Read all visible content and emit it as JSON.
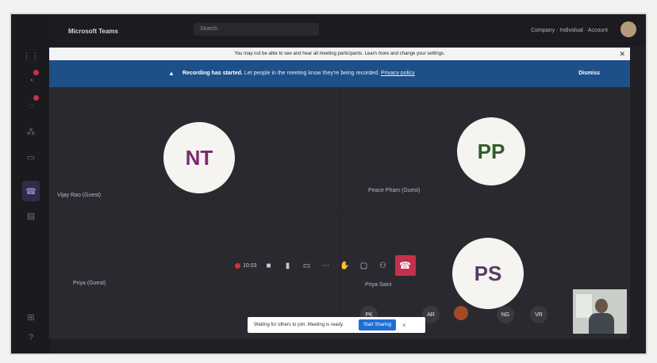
{
  "app": {
    "name": "Microsoft Teams",
    "search_placeholder": "Search",
    "org": "Company · Individual · Account"
  },
  "notice1": {
    "text": "You may not be able to see and hear all meeting participants. Learn more and change your settings.",
    "link": "Learn more"
  },
  "notice2": {
    "warn_icon": "warning-icon",
    "prefix": "Recording has started.",
    "text": "Let people in the meeting know they're being recorded.",
    "link": "Privacy policy",
    "dismiss": "Dismiss"
  },
  "participants": [
    {
      "initials": "NT",
      "name": "Vijay Rao (Guest)",
      "color": "#7a2b6e"
    },
    {
      "initials": "PP",
      "name": "Peace Pham (Guest)",
      "color": "#2e5f2a"
    },
    {
      "initials": "",
      "name": "Priya (Guest)",
      "color": ""
    },
    {
      "initials": "PS",
      "name": "Priya Saini",
      "color": "#5a3a66"
    }
  ],
  "controls": {
    "timer": "10:03"
  },
  "toast": {
    "text": "Waiting for others to join. Meeting is ready.",
    "button": "Start Sharing",
    "close": "×"
  },
  "mini_avatars": [
    "PK",
    "AR",
    "",
    "NG",
    "VR"
  ]
}
